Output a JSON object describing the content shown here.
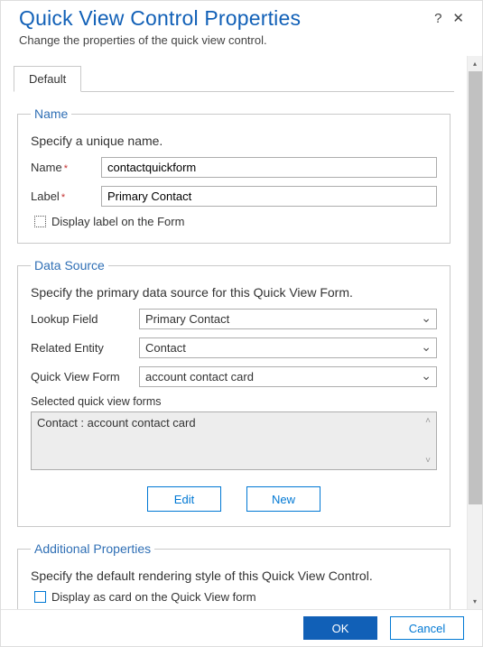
{
  "header": {
    "title": "Quick View Control Properties",
    "subtitle": "Change the properties of the quick view control.",
    "help_icon": "?",
    "close_icon": "✕"
  },
  "tabs": [
    {
      "label": "Default"
    }
  ],
  "groups": {
    "name_group": {
      "legend": "Name",
      "desc": "Specify a unique name.",
      "name_label": "Name",
      "name_value": "contactquickform",
      "label_label": "Label",
      "label_value": "Primary Contact",
      "display_label_checkbox": "Display label on the Form"
    },
    "data_source_group": {
      "legend": "Data Source",
      "desc": "Specify the primary data source for this Quick View Form.",
      "lookup_field_label": "Lookup Field",
      "lookup_field_value": "Primary Contact",
      "related_entity_label": "Related Entity",
      "related_entity_value": "Contact",
      "quick_view_form_label": "Quick View Form",
      "quick_view_form_value": "account contact card",
      "selected_label": "Selected quick view forms",
      "selected_item": "Contact : account contact card",
      "edit_button": "Edit",
      "new_button": "New"
    },
    "additional_group": {
      "legend": "Additional Properties",
      "desc": "Specify the default rendering style of this Quick View Control.",
      "card_checkbox": "Display as card on the Quick View form"
    }
  },
  "footer": {
    "ok": "OK",
    "cancel": "Cancel"
  }
}
